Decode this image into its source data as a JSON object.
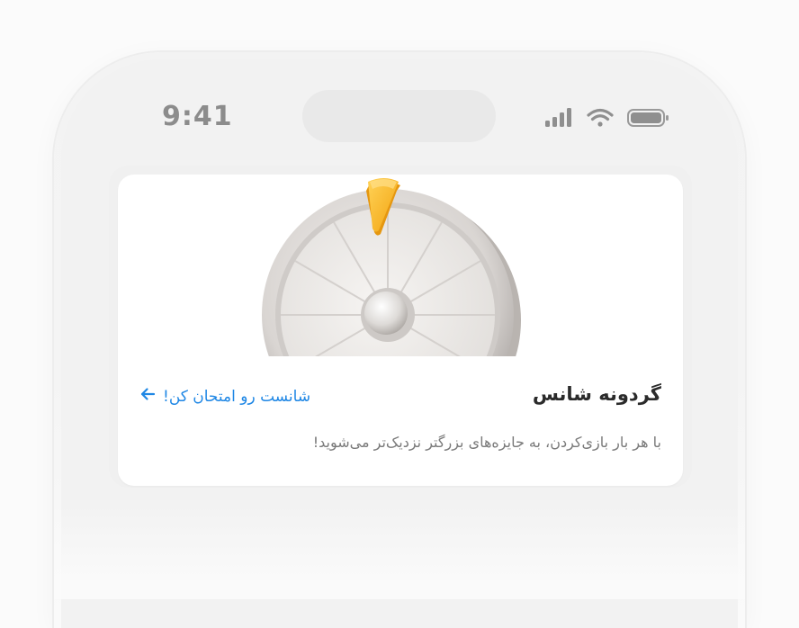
{
  "status_bar": {
    "time": "9:41",
    "icons": [
      "cellular-signal-icon",
      "wifi-icon",
      "battery-icon"
    ]
  },
  "card": {
    "image": "prize-wheel-illustration",
    "title": "گردونه شانس",
    "link_label": "شانست رو امتحان کن!",
    "link_icon": "arrow-left-icon",
    "description": "با هر بار بازی‌کردن، به جایزه‌های بزرگتر نزدیک‌تر می‌شوید!"
  },
  "colors": {
    "accent": "#1f87e5",
    "pointer": "#f6b21b",
    "title": "#2b2b2b",
    "description": "#7a7a7a"
  }
}
